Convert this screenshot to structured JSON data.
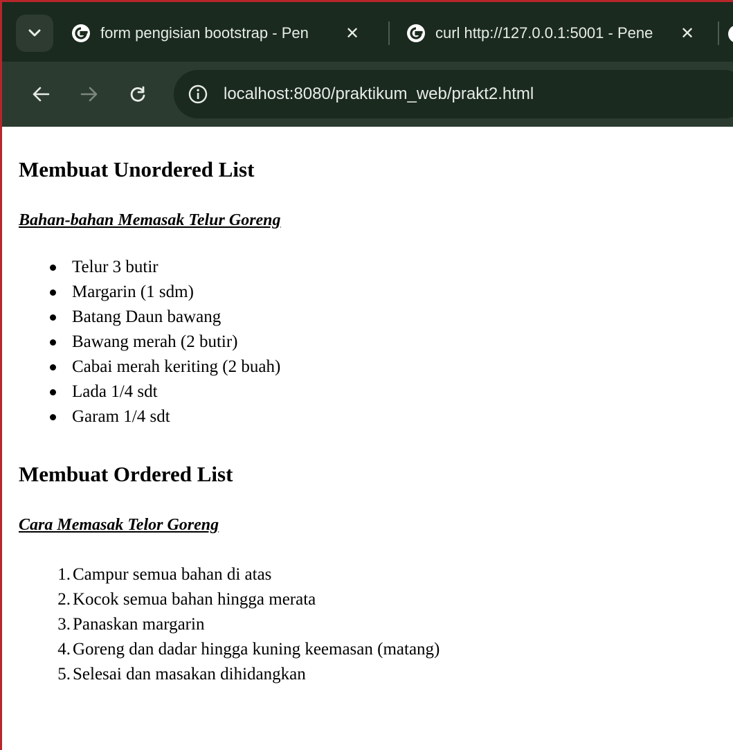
{
  "browser": {
    "tabs": [
      {
        "title": "form pengisian bootstrap - Pen",
        "close": "✕"
      },
      {
        "title": "curl http://127.0.0.1:5001 - Pene",
        "close": "✕"
      }
    ],
    "url": "localhost:8080/praktikum_web/prakt2.html",
    "accent": "#1a2a1e"
  },
  "page": {
    "unordered_heading": "Membuat Unordered List",
    "ingredients_title": "Bahan-bahan Memasak Telur Goreng",
    "ingredients": [
      "Telur 3 butir",
      "Margarin (1 sdm)",
      "Batang Daun bawang",
      "Bawang merah (2 butir)",
      "Cabai merah keriting (2 buah)",
      "Lada 1/4 sdt",
      "Garam 1/4 sdt"
    ],
    "ordered_heading": "Membuat Ordered List",
    "steps_title": "Cara Memasak Telor Goreng",
    "steps": [
      "Campur semua bahan di atas",
      "Kocok semua bahan hingga merata",
      "Panaskan margarin",
      "Goreng dan dadar hingga kuning keemasan (matang)",
      "Selesai dan masakan dihidangkan"
    ]
  }
}
